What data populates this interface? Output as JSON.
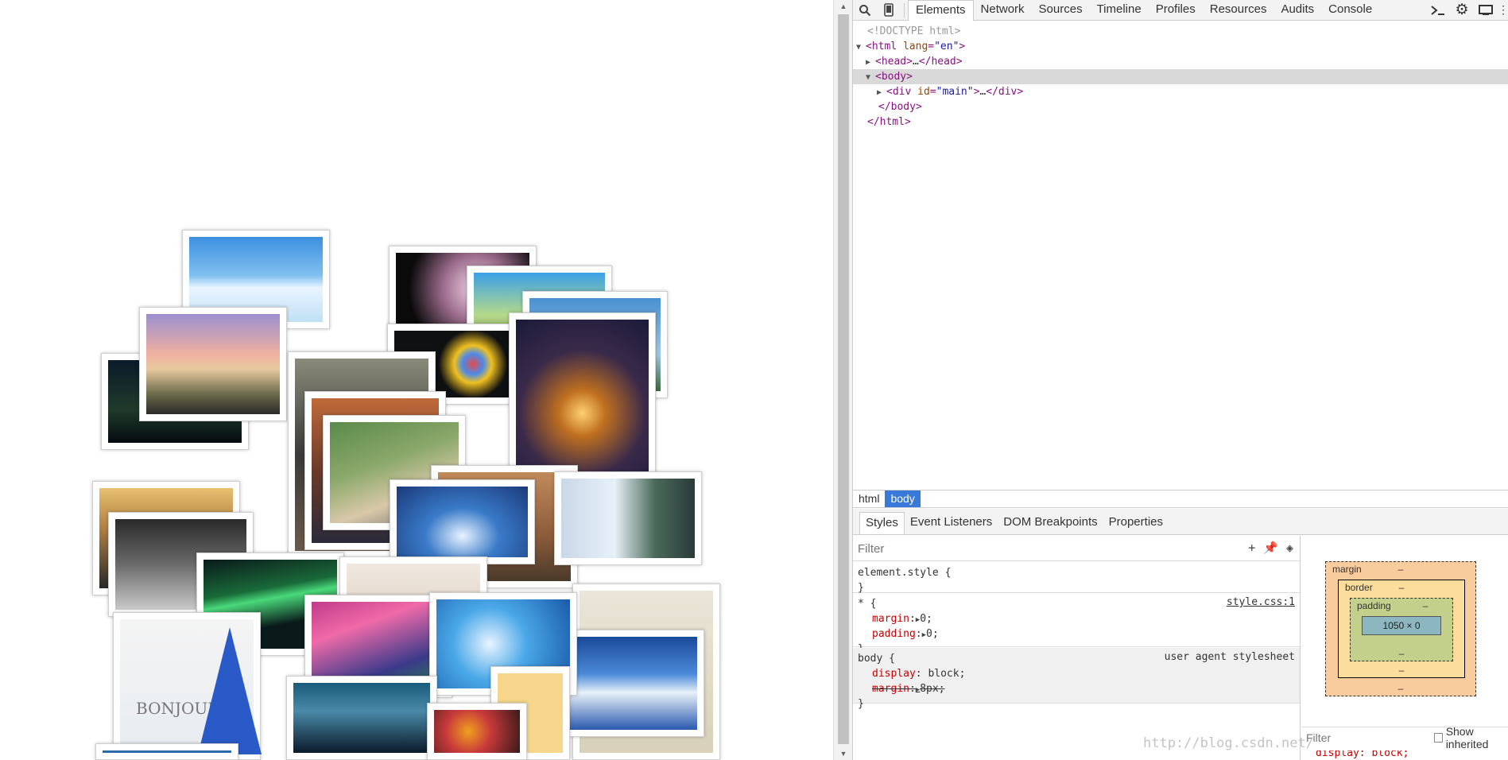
{
  "devtools": {
    "tabs": [
      {
        "label": "Elements",
        "active": true
      },
      {
        "label": "Network",
        "active": false
      },
      {
        "label": "Sources",
        "active": false
      },
      {
        "label": "Timeline",
        "active": false
      },
      {
        "label": "Profiles",
        "active": false
      },
      {
        "label": "Resources",
        "active": false
      },
      {
        "label": "Audits",
        "active": false
      },
      {
        "label": "Console",
        "active": false
      }
    ],
    "dom": {
      "doctype": "<!DOCTYPE html>",
      "html_open_tag": "html",
      "html_attr_name": "lang",
      "html_attr_value": "\"en\"",
      "head": "head",
      "head_ellipsis": "…",
      "body": "body",
      "div": "div",
      "div_attr_name": "id",
      "div_attr_value": "\"main\"",
      "div_ellipsis": "…",
      "body_close": "body",
      "html_close": "html"
    },
    "breadcrumbs": [
      "html",
      "body"
    ],
    "sub_tabs": [
      "Styles",
      "Event Listeners",
      "DOM Breakpoints",
      "Properties"
    ],
    "styles": {
      "filter_placeholder": "Filter",
      "rules": [
        {
          "selector": "element.style {",
          "close": "}",
          "source": "",
          "props": []
        },
        {
          "selector": "* {",
          "close": "}",
          "source": "style.css:1",
          "props": [
            {
              "name": "margin",
              "value": "0;"
            },
            {
              "name": "padding",
              "value": "0;"
            }
          ]
        },
        {
          "selector": "body {",
          "close": "}",
          "source": "user agent stylesheet",
          "props": [
            {
              "name": "display",
              "value": "block;"
            },
            {
              "name": "margin",
              "value": "8px;"
            }
          ]
        }
      ]
    },
    "metrics": {
      "margin_label": "margin",
      "border_label": "border",
      "padding_label": "padding",
      "content_size": "1050 × 0",
      "dash": "–",
      "filter_placeholder": "Filter",
      "show_inherited": "Show inherited",
      "clipped_prop": "display: block;"
    }
  },
  "page": {
    "photo_text": "BONJOUR!"
  },
  "watermark": "http://blog.csdn.net/"
}
